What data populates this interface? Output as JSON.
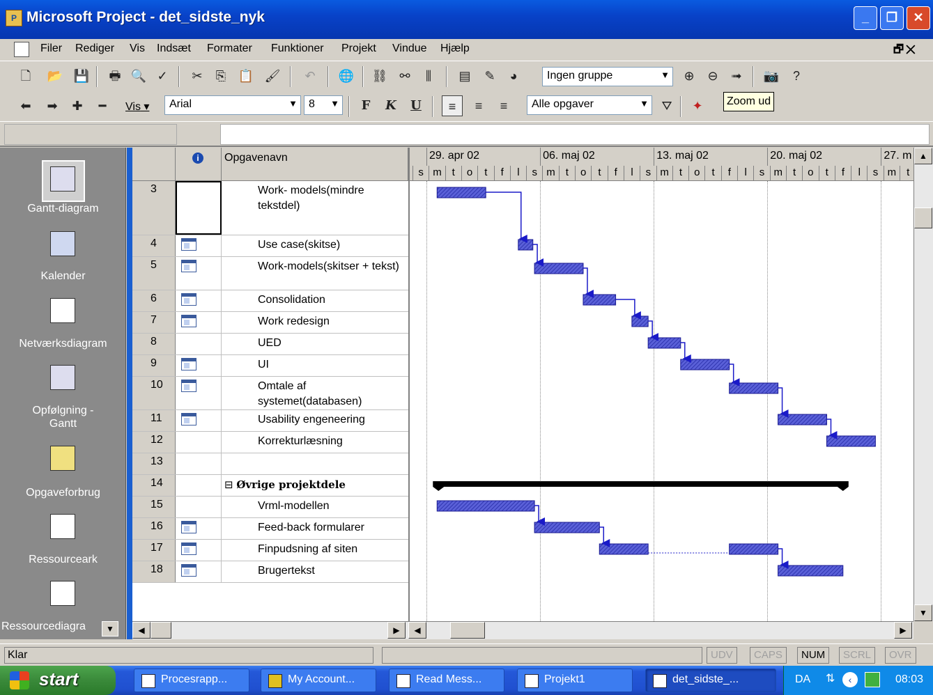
{
  "window": {
    "title": "Microsoft Project - det_sidste_nyk"
  },
  "menu": [
    "Filer",
    "Rediger",
    "Vis",
    "Indsæt",
    "Formater",
    "Funktioner",
    "Projekt",
    "Vindue",
    "Hjælp"
  ],
  "toolbar": {
    "group_combo": "Ingen gruppe",
    "view_label": "Vis",
    "font_combo": "Arial",
    "size_combo": "8",
    "bold": "F",
    "italic": "K",
    "underline": "U",
    "filter_combo": "Alle opgaver",
    "tooltip": "Zoom ud"
  },
  "viewbar": [
    {
      "label": "Gantt-diagram",
      "icon": "gantt-chart-icon"
    },
    {
      "label": "Kalender",
      "icon": "calendar-icon"
    },
    {
      "label": "Netværksdiagram",
      "icon": "network-diagram-icon"
    },
    {
      "label": "Opfølgning - Gantt",
      "icon": "tracking-gantt-icon"
    },
    {
      "label": "Opgaveforbrug",
      "icon": "task-usage-icon"
    },
    {
      "label": "Ressourceark",
      "icon": "resource-sheet-icon"
    },
    {
      "label": "Ressourcediagra",
      "icon": "resource-graph-icon"
    }
  ],
  "grid": {
    "columns": {
      "info": "i",
      "name": "Opgavenavn"
    },
    "rows": [
      {
        "id": "3",
        "name": "Work- models(mindre tekstdel)",
        "note": false
      },
      {
        "id": "4",
        "name": "Use case(skitse)",
        "note": true
      },
      {
        "id": "5",
        "name": "Work-models(skitser + tekst)",
        "note": true
      },
      {
        "id": "6",
        "name": "Consolidation",
        "note": true
      },
      {
        "id": "7",
        "name": "Work redesign",
        "note": true
      },
      {
        "id": "8",
        "name": "UED",
        "note": false
      },
      {
        "id": "9",
        "name": "UI",
        "note": true
      },
      {
        "id": "10",
        "name": "Omtale af systemet(databasen)",
        "note": true
      },
      {
        "id": "11",
        "name": "Usability engeneering",
        "note": true
      },
      {
        "id": "12",
        "name": "Korrekturlæsning",
        "note": false
      },
      {
        "id": "13",
        "name": "",
        "note": false
      },
      {
        "id": "14",
        "name": "Øvrige projektdele",
        "note": false,
        "summary": true
      },
      {
        "id": "15",
        "name": "Vrml-modellen",
        "note": false
      },
      {
        "id": "16",
        "name": "Feed-back formularer",
        "note": true
      },
      {
        "id": "17",
        "name": "Finpudsning af siten",
        "note": true
      },
      {
        "id": "18",
        "name": "Brugertekst",
        "note": true
      }
    ]
  },
  "timescale": {
    "weeks": [
      "29. apr 02",
      "06. maj 02",
      "13. maj 02",
      "20. maj 02",
      "27. m"
    ],
    "days": [
      "s",
      "m",
      "t",
      "o",
      "t",
      "f",
      "l",
      "s",
      "m",
      "t",
      "o",
      "t",
      "f",
      "l",
      "s",
      "m",
      "t",
      "o",
      "t",
      "f",
      "l",
      "s",
      "m",
      "t",
      "o",
      "t",
      "f",
      "l",
      "s",
      "m",
      "t"
    ]
  },
  "status": {
    "text": "Klar",
    "keys": [
      {
        "label": "UDV",
        "on": false
      },
      {
        "label": "CAPS",
        "on": false
      },
      {
        "label": "NUM",
        "on": true
      },
      {
        "label": "SCRL",
        "on": false
      },
      {
        "label": "OVR",
        "on": false
      }
    ]
  },
  "taskbar": {
    "start": "start",
    "tasks": [
      "Procesrapp...",
      "My Account...",
      "Read Mess...",
      "Projekt1",
      "det_sidste_..."
    ],
    "lang": "DA",
    "time": "08:03"
  }
}
